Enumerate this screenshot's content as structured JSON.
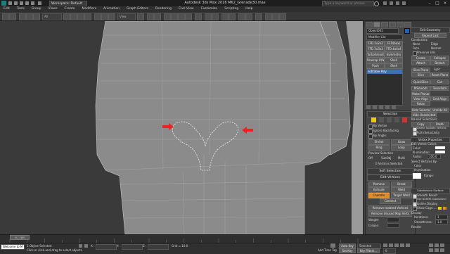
{
  "window": {
    "title": "Autodesk 3ds Max 2016 MK2_Grenade30.max",
    "workspace": "Workspace: Default",
    "search_placeholder": "Type a keyword or phrase"
  },
  "menu": [
    "Edit",
    "Tools",
    "Group",
    "Views",
    "Create",
    "Modifiers",
    "Animation",
    "Graph Editors",
    "Rendering",
    "Civil View",
    "Customize",
    "Scripting",
    "Help"
  ],
  "viewport": {
    "label": "[ + ] [ Orthographic ] [ Shaded + Edged Faces ]"
  },
  "command_panel": {
    "object_name": "Object001",
    "modifier_list": "Modifier List",
    "modifier_buttons": [
      "FFD 2x2x2",
      "FFD(box)",
      "FFD 3x3x3",
      "FFD 4x4x4",
      "TurboSmooth",
      "Symmetry",
      "Unwrap UVW",
      "Shell",
      "Push",
      "Shell"
    ],
    "stack_item": "Editable Poly",
    "selection": {
      "header": "Selection",
      "by_vertex": "By Vertex",
      "ignore_backfacing": "Ignore Backfacing",
      "by_angle": "By Angle:",
      "grow": "Grow",
      "shrink": "Shrink",
      "ring": "Ring",
      "loop": "Loop",
      "preview_selection": "Preview Selection",
      "off": "Off",
      "subobj": "SubObj",
      "multi": "Multi",
      "status": "0 Vertices Selected"
    },
    "soft_selection": {
      "header": "Soft Selection"
    },
    "edit_vertices": {
      "header": "Edit Vertices",
      "remove": "Remove",
      "break": "Break",
      "extrude": "Extrude",
      "weld": "Weld",
      "chamfer": "Chamfer",
      "target_weld": "Target Weld",
      "connect": "Connect",
      "remove_isolated": "Remove Isolated Vertices",
      "remove_unused_map": "Remove Unused Map Verts",
      "weight": "Weight:",
      "crease": "Crease:"
    }
  },
  "right_column": {
    "edit_geometry": "Edit Geometry",
    "repeat_last": "Repeat Last",
    "constraints": "Constraints",
    "none": "None",
    "edge": "Edge",
    "face": "Face",
    "normal": "Normal",
    "preserve_uvs": "Preserve UVs",
    "create": "Create",
    "collapse": "Collapse",
    "attach": "Attach",
    "detach": "Detach",
    "slice_plane": "Slice Plane",
    "split": "Split",
    "slice": "Slice",
    "reset_plane": "Reset Plane",
    "quickslice": "QuickSlice",
    "cut": "Cut",
    "msmooth": "MSmooth",
    "tessellate": "Tessellate",
    "make_planar": "Make Planar",
    "view_align": "View Align",
    "grid_align": "Grid Align",
    "relax": "Relax",
    "hide_selected": "Hide Selected",
    "unhide_all": "Unhide All",
    "hide_unselected": "Hide Unselected",
    "named_selections": "Named Selections:",
    "copy": "Copy",
    "paste": "Paste",
    "delete_isolated": "Delete Isolated Vertices",
    "full_interactivity": "Full Interactivity",
    "vertex_properties": "Vertex Properties",
    "edit_vertex_colors": "Edit Vertex Colors",
    "color": "Color:",
    "illumination": "Illumination:",
    "alpha": "Alpha:",
    "alpha_value": "100.0",
    "select_vertices_by": "Select Vertices By",
    "color_radio": "Color",
    "illumination_radio": "Illumination",
    "range": "Range:",
    "subdivision_surface": "Subdivision Surface",
    "smooth_result": "Smooth Result",
    "use_nurms": "Use NURMS Subdivision",
    "isoline_display": "Isoline Display",
    "show_cage": "Show Cage......",
    "display": "Display",
    "iterations": "Iterations:",
    "iterations_value": "1",
    "smoothness": "Smoothness:",
    "smoothness_value": "1.0",
    "render": "Render"
  },
  "timeline": {
    "frame": "0 / 100"
  },
  "status": {
    "maxscript": "Welcome to M",
    "selection": "1 Object Selected",
    "hint": "Click or click-and-drag to select objects",
    "x_label": "X:",
    "y_label": "Y:",
    "z_label": "Z:",
    "grid": "Grid = 10.0",
    "autokey": "Auto Key",
    "set_key": "Set Key",
    "selected": "Selected",
    "key_filters": "Key Filters...",
    "add_time_tag": "Add Time Tag"
  },
  "colors": {
    "accent": "#e08a2a",
    "mesh": "#8a8a8a",
    "arrow": "#e22222",
    "viewport_bg": "#3a3a3a",
    "swatch_yellow": "#e8d000"
  }
}
